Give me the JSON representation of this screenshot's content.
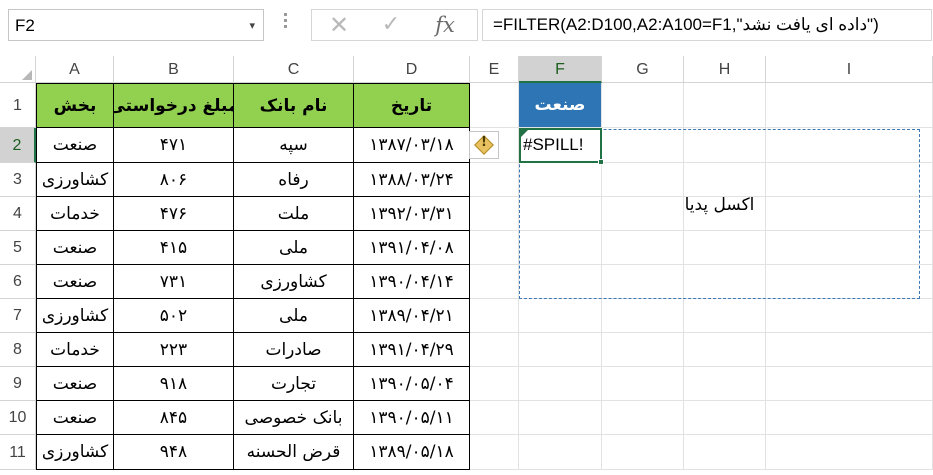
{
  "formula_bar": {
    "name_box": "F2",
    "name_box_arrow": "▾",
    "cancel_icon": "✕",
    "enter_icon": "✓",
    "fx_label": "fx",
    "formula": "=FILTER(A2:D100,A2:A100=F1,\"داده ای یافت نشد\")"
  },
  "columns": [
    "A",
    "B",
    "C",
    "D",
    "E",
    "F",
    "G",
    "H",
    "I"
  ],
  "selected_column": "F",
  "rows": [
    "1",
    "2",
    "3",
    "4",
    "5",
    "6",
    "7",
    "8",
    "9",
    "10",
    "11"
  ],
  "selected_row": "2",
  "table": {
    "headers": {
      "section": "بخش",
      "amount": "مبلغ درخواستی",
      "bank": "نام بانک",
      "date": "تاریخ"
    },
    "rows": [
      {
        "section": "صنعت",
        "amount": "۴۷۱",
        "bank": "سپه",
        "date": "۱۳۸۷/۰۳/۱۸"
      },
      {
        "section": "کشاورزی",
        "amount": "۸۰۶",
        "bank": "رفاه",
        "date": "۱۳۸۸/۰۳/۲۴"
      },
      {
        "section": "خدمات",
        "amount": "۴۷۶",
        "bank": "ملت",
        "date": "۱۳۹۲/۰۳/۳۱"
      },
      {
        "section": "صنعت",
        "amount": "۴۱۵",
        "bank": "ملی",
        "date": "۱۳۹۱/۰۴/۰۸"
      },
      {
        "section": "صنعت",
        "amount": "۷۳۱",
        "bank": "کشاورزی",
        "date": "۱۳۹۰/۰۴/۱۴"
      },
      {
        "section": "کشاورزی",
        "amount": "۵۰۲",
        "bank": "ملی",
        "date": "۱۳۸۹/۰۴/۲۱"
      },
      {
        "section": "خدمات",
        "amount": "۲۲۳",
        "bank": "صادرات",
        "date": "۱۳۹۱/۰۴/۲۹"
      },
      {
        "section": "صنعت",
        "amount": "۹۱۸",
        "bank": "تجارت",
        "date": "۱۳۹۰/۰۵/۰۴"
      },
      {
        "section": "صنعت",
        "amount": "۸۴۵",
        "bank": "بانک خصوصی",
        "date": "۱۳۹۰/۰۵/۱۱"
      },
      {
        "section": "کشاورزی",
        "amount": "۹۴۸",
        "bank": "قرض الحسنه",
        "date": "۱۳۸۹/۰۵/۱۸"
      }
    ]
  },
  "criteria": {
    "header": "صنعت",
    "result": "#SPILL!",
    "spill_range_text": "اکسل پدیا",
    "warning_icon": "!"
  },
  "colors": {
    "header_green": "#92d050",
    "header_blue": "#2e75b6",
    "selection_green": "#217346",
    "spill_border": "#3c78b5"
  }
}
